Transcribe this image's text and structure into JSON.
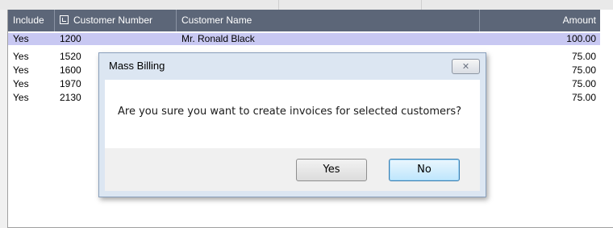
{
  "grid": {
    "columns": {
      "include": "Include",
      "customer_number": "Customer Number",
      "customer_name": "Customer Name",
      "amount": "Amount"
    },
    "rows": [
      {
        "include": "Yes",
        "customer_number": "1200",
        "customer_name": "Mr. Ronald Black",
        "amount": "100.00"
      },
      {
        "include": "Yes",
        "customer_number": "1520",
        "customer_name": "",
        "amount": "75.00"
      },
      {
        "include": "Yes",
        "customer_number": "1600",
        "customer_name": "",
        "amount": "75.00"
      },
      {
        "include": "Yes",
        "customer_number": "1970",
        "customer_name": "",
        "amount": "75.00"
      },
      {
        "include": "Yes",
        "customer_number": "2130",
        "customer_name": "",
        "amount": "75.00"
      }
    ]
  },
  "dialog": {
    "title": "Mass Billing",
    "close_icon": "close-icon",
    "close_glyph": "✕",
    "message": "Are you sure you want to create invoices for selected customers?",
    "yes_label": "Yes",
    "no_label": "No"
  },
  "colors": {
    "header_bg": "#5c6678",
    "selected_row_bg": "#c8c8f2",
    "dialog_frame": "#dce6f2"
  }
}
